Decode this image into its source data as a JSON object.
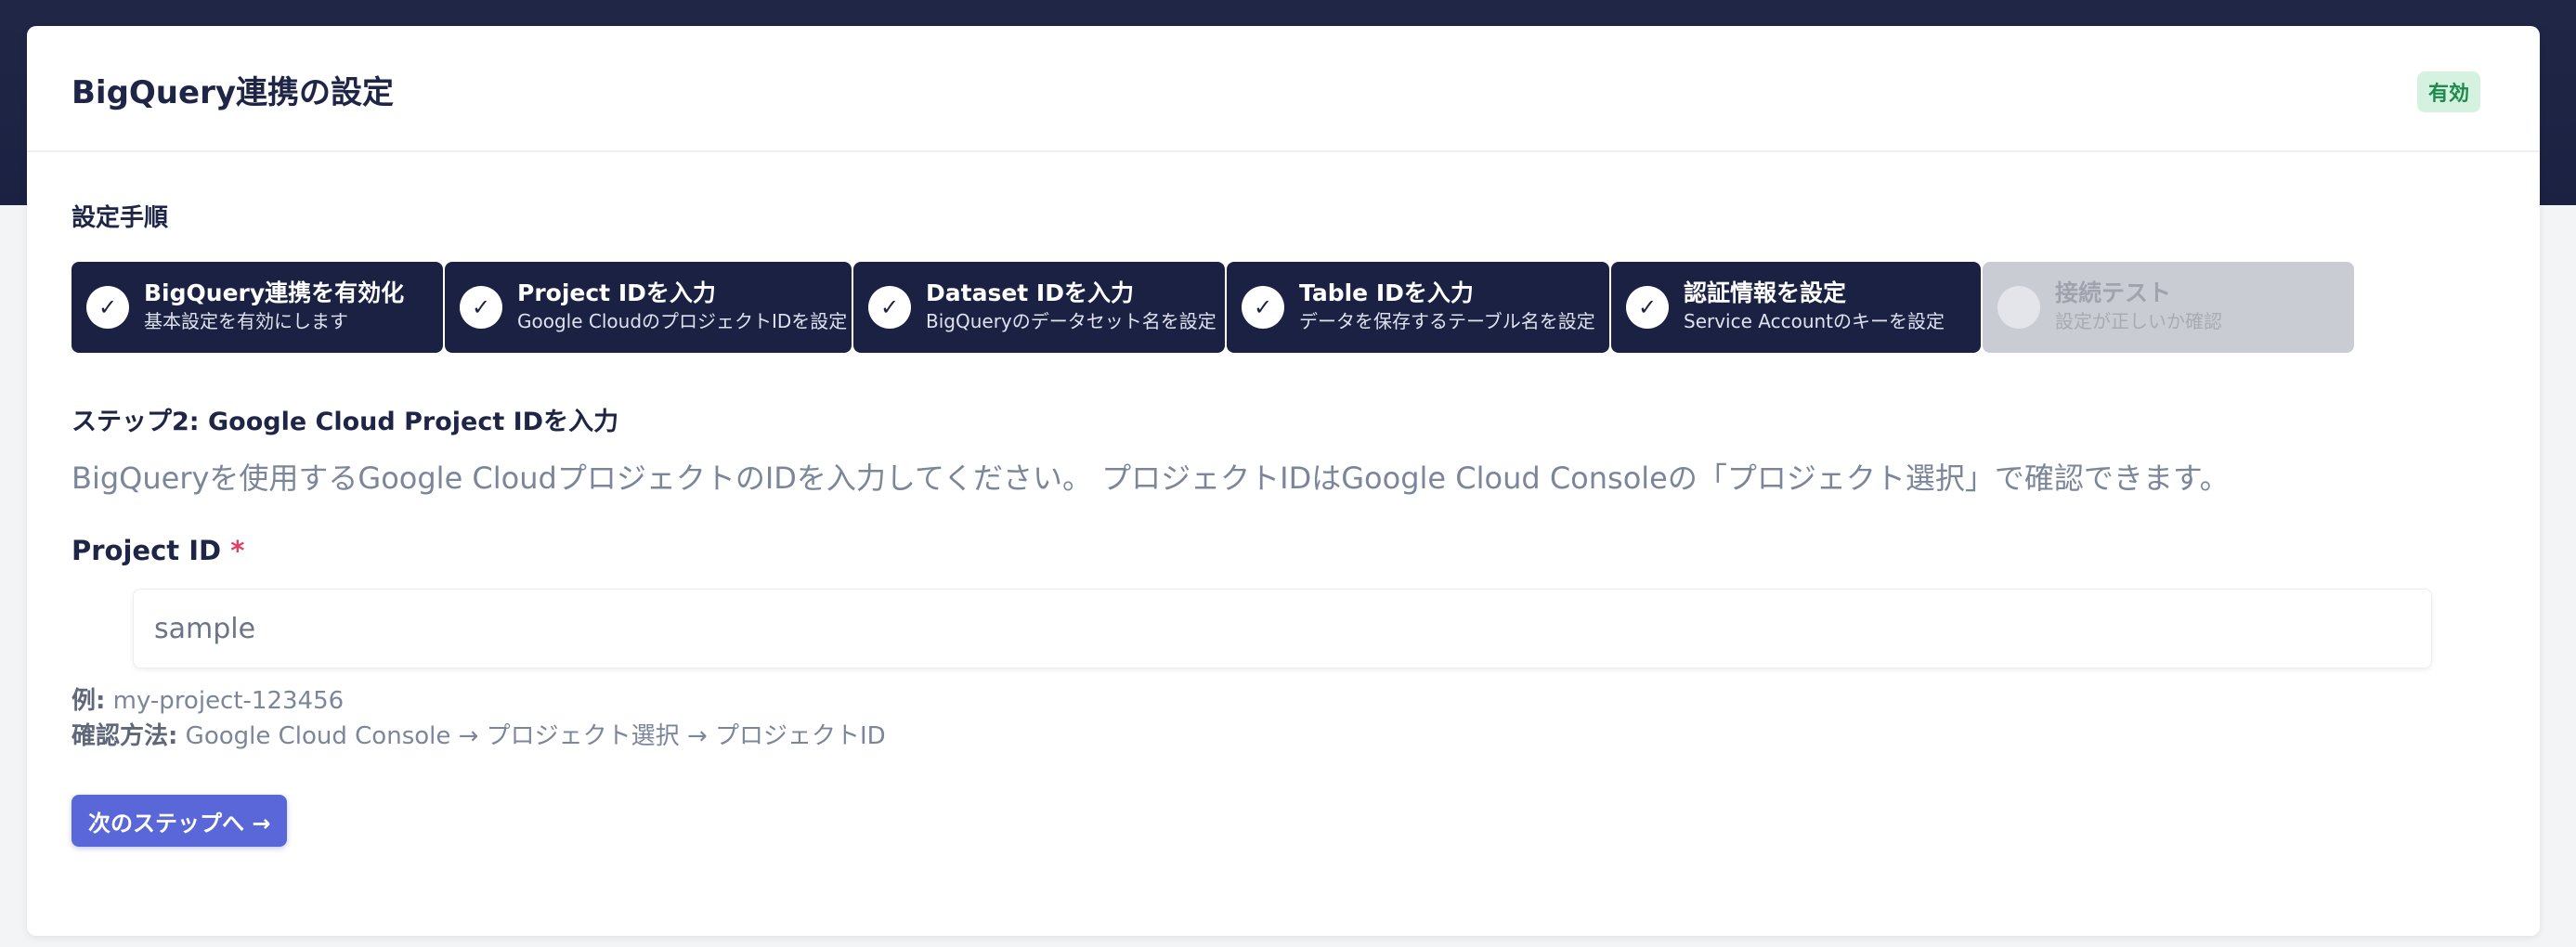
{
  "header": {
    "title": "BigQuery連携の設定",
    "status_badge": "有効"
  },
  "setup": {
    "section_label": "設定手順",
    "steps": [
      {
        "title": "BigQuery連携を有効化",
        "subtitle": "基本設定を有効にします",
        "status": "done",
        "icon": "✓"
      },
      {
        "title": "Project IDを入力",
        "subtitle": "Google CloudのプロジェクトIDを設定",
        "status": "done",
        "icon": "✓"
      },
      {
        "title": "Dataset IDを入力",
        "subtitle": "BigQueryのデータセット名を設定",
        "status": "done",
        "icon": "✓"
      },
      {
        "title": "Table IDを入力",
        "subtitle": "データを保存するテーブル名を設定",
        "status": "done",
        "icon": "✓"
      },
      {
        "title": "認証情報を設定",
        "subtitle": "Service Accountのキーを設定",
        "status": "done",
        "icon": "✓"
      },
      {
        "title": "接続テスト",
        "subtitle": "設定が正しいか確認",
        "status": "pending",
        "icon": "6"
      }
    ]
  },
  "step_content": {
    "heading": "ステップ2: Google Cloud Project IDを入力",
    "description": "BigQueryを使用するGoogle CloudプロジェクトのIDを入力してください。 プロジェクトIDはGoogle Cloud Consoleの「プロジェクト選択」で確認できます。",
    "field_label": "Project ID",
    "required_mark": "*",
    "input_value": "sample",
    "example_label": "例:",
    "example_value": "my-project-123456",
    "howto_label": "確認方法:",
    "howto_value": "Google Cloud Console → プロジェクト選択 → プロジェクトID",
    "next_button": "次のステップへ →"
  },
  "colors": {
    "header_band": "#1b2142",
    "step_done": "#1b2142",
    "step_pending": "#c9ccd3",
    "accent_button": "#5a67d8",
    "badge_bg": "#d5f2e1",
    "badge_text": "#1f8a4d",
    "required": "#e53e63"
  }
}
